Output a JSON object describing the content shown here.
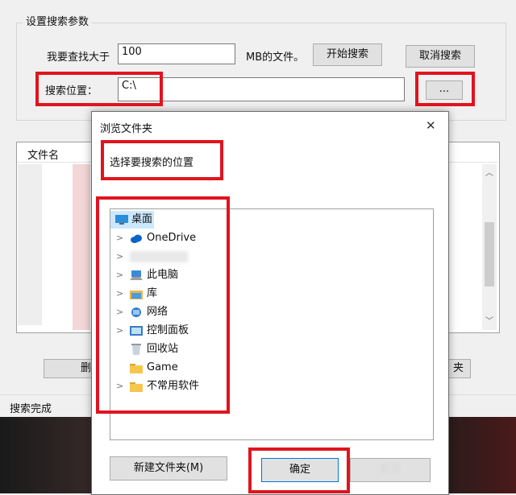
{
  "group": {
    "title": "设置搜索参数"
  },
  "search_row": {
    "label": "我要查找大于",
    "size_value": "100",
    "unit": "MB的文件。",
    "start_button": "开始搜索",
    "cancel_button": "取消搜索"
  },
  "location_row": {
    "label": "搜索位置：",
    "path_value": "C:\\",
    "browse_button": "..."
  },
  "results": {
    "column_filename": "文件名",
    "delete_button_partial": "删",
    "folder_button_partial": "夹"
  },
  "status": {
    "text": "搜索完成"
  },
  "dialog": {
    "title": "浏览文件夹",
    "prompt": "选择要搜索的位置",
    "tree": [
      {
        "label": "桌面",
        "icon": "desktop-icon",
        "expandable": false,
        "selected": true
      },
      {
        "label": "OneDrive",
        "icon": "cloud-icon",
        "expandable": true
      },
      {
        "label": "",
        "icon": "blurred",
        "expandable": true
      },
      {
        "label": "此电脑",
        "icon": "computer-icon",
        "expandable": true
      },
      {
        "label": "库",
        "icon": "library-icon",
        "expandable": true
      },
      {
        "label": "网络",
        "icon": "network-icon",
        "expandable": true
      },
      {
        "label": "控制面板",
        "icon": "control-panel-icon",
        "expandable": true
      },
      {
        "label": "回收站",
        "icon": "recycle-bin-icon",
        "expandable": false
      },
      {
        "label": "Game",
        "icon": "folder-icon",
        "expandable": false
      },
      {
        "label": "不常用软件",
        "icon": "folder-icon",
        "expandable": true
      }
    ],
    "new_folder_button": "新建文件夹(M)",
    "ok_button": "确定",
    "cancel_button": "取消",
    "close_glyph": "✕"
  },
  "colors": {
    "highlight": "#e0141e",
    "selected": "#cce8ff",
    "accent": "#0078d7"
  }
}
